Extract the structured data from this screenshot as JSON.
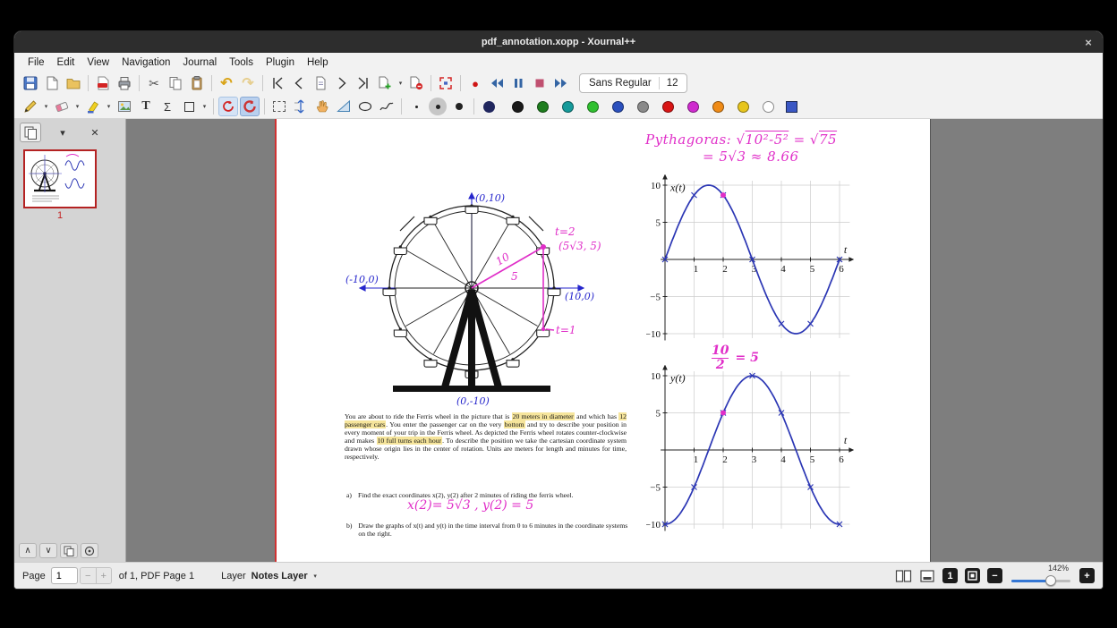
{
  "window": {
    "title": "pdf_annotation.xopp - Xournal++",
    "close_label": "×"
  },
  "menu": {
    "items": [
      "File",
      "Edit",
      "View",
      "Navigation",
      "Journal",
      "Tools",
      "Plugin",
      "Help"
    ]
  },
  "toolbar1": {
    "font_name": "Sans Regular",
    "font_size": "12"
  },
  "toolbar2": {
    "colors": [
      {
        "name": "black",
        "hex": "#1a1a1a"
      },
      {
        "name": "green",
        "hex": "#1e7d1e"
      },
      {
        "name": "teal",
        "hex": "#159a9a"
      },
      {
        "name": "light-green",
        "hex": "#2fc02f"
      },
      {
        "name": "blue",
        "hex": "#2b50bd"
      },
      {
        "name": "gray",
        "hex": "#8a8a8a"
      },
      {
        "name": "red",
        "hex": "#d81515"
      },
      {
        "name": "magenta",
        "hex": "#cf2bcf"
      },
      {
        "name": "orange",
        "hex": "#ef8b17"
      },
      {
        "name": "yellow",
        "hex": "#e7c51c"
      },
      {
        "name": "white",
        "hex": "#ffffff"
      }
    ],
    "selected_color": "#3a57c4"
  },
  "sidebar": {
    "page_number": "1"
  },
  "statusbar": {
    "page_label": "Page",
    "page_value": "1",
    "minus": "−",
    "plus": "+",
    "of_label": "of 1, PDF Page 1",
    "layer_label": "Layer",
    "layer_value": "Notes Layer",
    "zoom_value": "142%",
    "zoom_100": "1",
    "zoom_out": "−",
    "zoom_in": "+"
  },
  "doc": {
    "pyth": {
      "word": "Pythagoras:",
      "sqrt": "√",
      "rad1": "10²-5²",
      "eq": "=",
      "rad2": "75",
      "line2": "= 5√3 ≈ 8.66"
    },
    "wheel": {
      "top": "(0,10)",
      "left": "(-10,0)",
      "right": "(10,0)",
      "bottom": "(0,-10)",
      "t2": "t=2",
      "p2": "(5√3, 5)",
      "t1": "t=1",
      "r10": "10",
      "r5": "5"
    },
    "frac": {
      "num": "10",
      "den": "2",
      "rhs": "= 5"
    },
    "para": {
      "s1": "You are about to ride the Ferris wheel in the picture that is ",
      "h1": "20 meters in diameter",
      "s2": " and which has ",
      "h2": "12 passenger cars",
      "s3": ".  You enter the passenger car on the very ",
      "h3": "bottom",
      "s4": " and try to describe your position in every moment of your trip in the Ferris wheel. As depicted the Ferris wheel rotates counter-clockwise and makes ",
      "h4": "10 full turns each hour",
      "s5": ". To describe the position we take the cartesian coordinate system drawn whose origin lies in the center of rotation. Units are meters for length and minutes for time, respectively."
    },
    "items": {
      "a_label": "a)",
      "a_text": "Find the exact coordinates x(2), y(2) after 2 minutes of riding the ferris wheel.",
      "answer": "x(2)= 5√3 , y(2) = 5",
      "b_label": "b)",
      "b_text": "Draw the graphs of x(t) and y(t) in the time interval from 0 to 6 minutes in the coordinate systems on the right."
    }
  },
  "chart_data": [
    {
      "id": "chart-x",
      "type": "line",
      "title": "x(t)",
      "xlabel": "t",
      "x_ticks": [
        1,
        2,
        3,
        4,
        5,
        6
      ],
      "y_ticks": [
        10,
        5,
        -5,
        -10
      ],
      "xlim": [
        0,
        6.5
      ],
      "ylim": [
        -11,
        11
      ],
      "grid": true,
      "func": {
        "kind": "sin",
        "amplitude": 10,
        "period": 6
      },
      "samples_t": [
        0,
        1,
        2,
        3,
        4,
        5,
        6
      ],
      "samples_v": [
        0,
        8.66,
        8.66,
        0,
        -8.66,
        -8.66,
        0
      ],
      "marked_point": {
        "t": 2,
        "v": 8.66
      }
    },
    {
      "id": "chart-y",
      "type": "line",
      "title": "y(t)",
      "xlabel": "t",
      "x_ticks": [
        1,
        2,
        3,
        4,
        5,
        6
      ],
      "y_ticks": [
        10,
        5,
        -5,
        -10
      ],
      "xlim": [
        0,
        6.5
      ],
      "ylim": [
        -11,
        11
      ],
      "grid": true,
      "func": {
        "kind": "neg-cos",
        "amplitude": 10,
        "period": 6
      },
      "samples_t": [
        0,
        1,
        2,
        3,
        4,
        5,
        6
      ],
      "samples_v": [
        -10,
        -5,
        5,
        10,
        5,
        -5,
        -10
      ],
      "marked_point": {
        "t": 2,
        "v": 5
      }
    }
  ]
}
